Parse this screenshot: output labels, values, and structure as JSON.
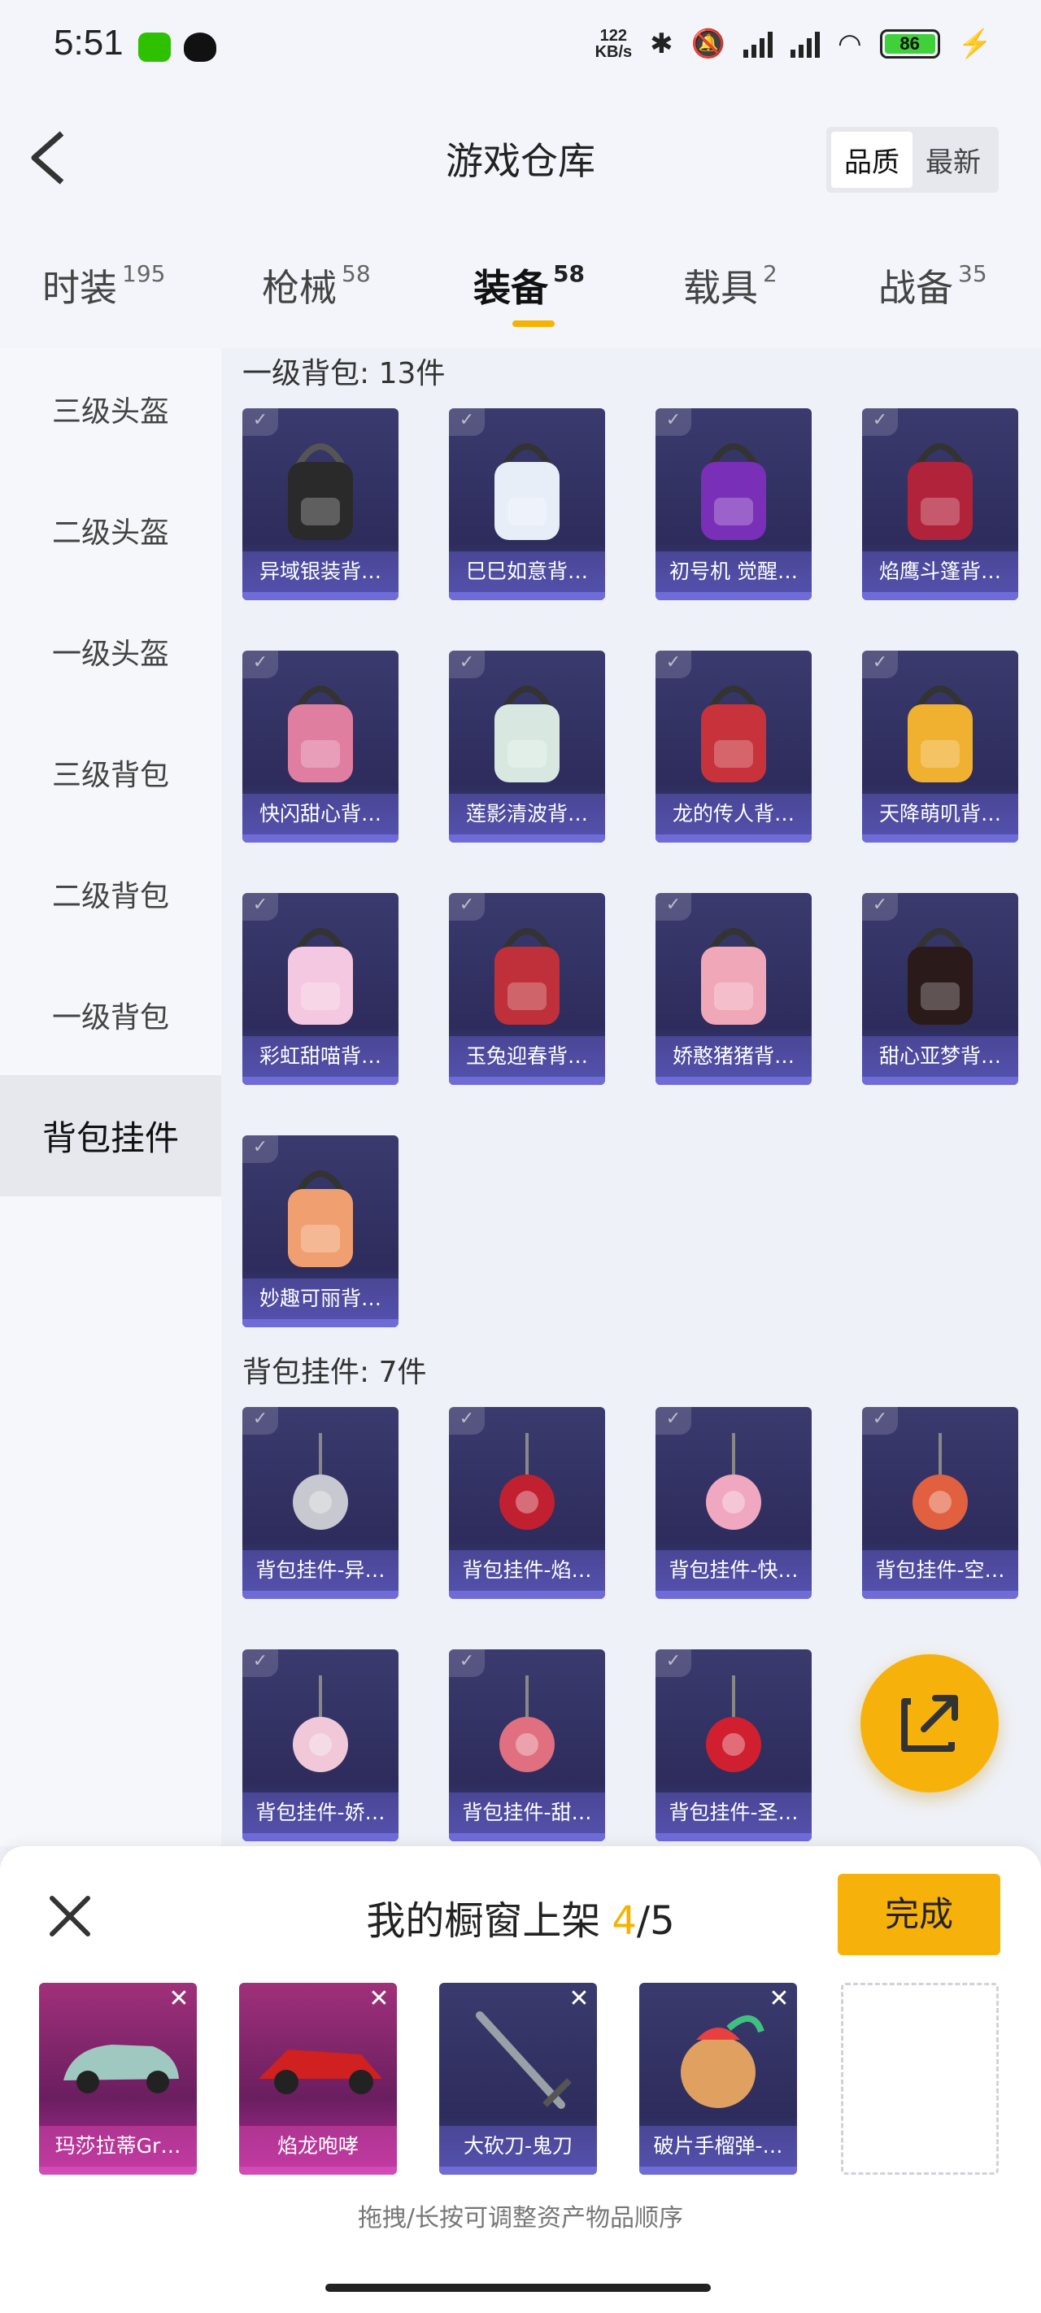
{
  "status_bar": {
    "time": "5:51",
    "net_speed_value": "122",
    "net_speed_unit": "KB/s",
    "battery": "86",
    "icons": [
      "wechat-icon",
      "qq-icon",
      "bluetooth-icon",
      "mute-icon",
      "signal-icon",
      "wifi-icon",
      "charging-icon"
    ]
  },
  "header": {
    "title": "游戏仓库",
    "sort_options": [
      "品质",
      "最新"
    ]
  },
  "tabs": [
    {
      "label": "时装",
      "count": "195"
    },
    {
      "label": "枪械",
      "count": "58"
    },
    {
      "label": "装备",
      "count": "58"
    },
    {
      "label": "载具",
      "count": "2"
    },
    {
      "label": "战备",
      "count": "35"
    }
  ],
  "sidebar": [
    "三级头盔",
    "二级头盔",
    "一级头盔",
    "三级背包",
    "二级背包",
    "一级背包",
    "背包挂件"
  ],
  "sections": [
    {
      "title": "一级背包: 13件",
      "items": [
        "异域银装背…",
        "巳巳如意背…",
        "初号机 觉醒…",
        "焰鹰斗篷背…",
        "快闪甜心背…",
        "莲影清波背…",
        "龙的传人背…",
        "天降萌叽背…",
        "彩虹甜喵背…",
        "玉兔迎春背…",
        "娇憨猪猪背…",
        "甜心亚梦背…",
        "妙趣可丽背…"
      ]
    },
    {
      "title": "背包挂件: 7件",
      "items": [
        "背包挂件-异…",
        "背包挂件-焰…",
        "背包挂件-快…",
        "背包挂件-空…",
        "背包挂件-娇…",
        "背包挂件-甜…",
        "背包挂件-圣…"
      ]
    }
  ],
  "panel": {
    "title": "我的橱窗上架",
    "current": "4",
    "separator_total": "/5",
    "done_label": "完成",
    "hint": "拖拽/长按可调整资产物品顺序",
    "shelf_items": [
      {
        "label": "玛莎拉蒂Gr…",
        "rarity": "pink"
      },
      {
        "label": "焰龙咆哮",
        "rarity": "pink"
      },
      {
        "label": "大砍刀-鬼刀",
        "rarity": "purple"
      },
      {
        "label": "破片手榴弹-…",
        "rarity": "purple"
      }
    ]
  },
  "colors": {
    "accent": "#f6b20a",
    "card_purple": "#3b3a6e",
    "card_pink": "#a0307a"
  }
}
